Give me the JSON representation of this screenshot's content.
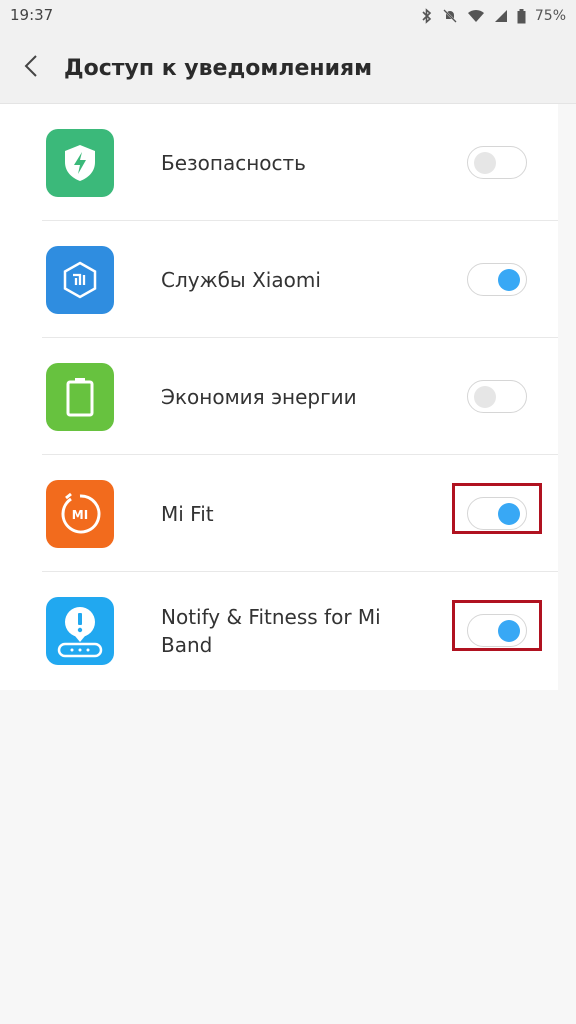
{
  "status_bar": {
    "time": "19:37",
    "battery": "75%",
    "icons": [
      "bluetooth-icon",
      "mute-icon",
      "wifi-icon",
      "signal-icon",
      "battery-icon"
    ]
  },
  "header": {
    "title": "Доступ к уведомлениям",
    "back_icon": "chevron-left-icon"
  },
  "apps": [
    {
      "label": "Безопасность",
      "icon": "security-shield-icon",
      "icon_color": "#3bb97a",
      "enabled": false,
      "highlighted": false
    },
    {
      "label": "Службы Xiaomi",
      "icon": "xiaomi-services-icon",
      "icon_color": "#2f8de0",
      "enabled": true,
      "highlighted": false
    },
    {
      "label": "Экономия энергии",
      "icon": "battery-saver-icon",
      "icon_color": "#67c23f",
      "enabled": false,
      "highlighted": false
    },
    {
      "label": "Mi Fit",
      "icon": "mi-fit-icon",
      "icon_color": "#f26b1d",
      "enabled": true,
      "highlighted": true
    },
    {
      "label_line1": "Notify & Fitness for Mi",
      "label_line2": "Band",
      "icon": "notify-fitness-icon",
      "icon_color": "#21a8f0",
      "enabled": true,
      "highlighted": true
    }
  ],
  "colors": {
    "toggle_on": "#38a8f5",
    "toggle_off": "#e6e6e6",
    "highlight_border": "#b01220"
  }
}
